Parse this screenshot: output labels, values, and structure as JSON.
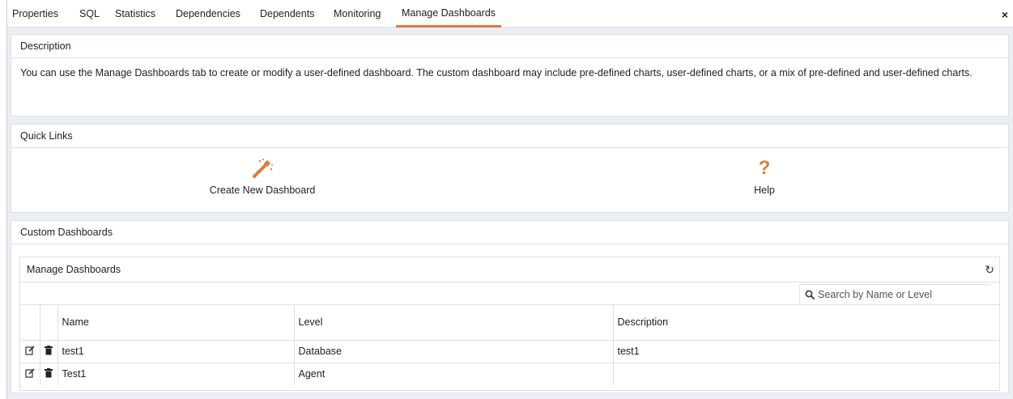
{
  "tabs": [
    {
      "label": "Properties"
    },
    {
      "label": "SQL"
    },
    {
      "label": "Statistics"
    },
    {
      "label": "Dependencies"
    },
    {
      "label": "Dependents"
    },
    {
      "label": "Monitoring"
    },
    {
      "label": "Manage Dashboards",
      "active": true
    }
  ],
  "close_label": "×",
  "description": {
    "title": "Description",
    "text": "You can use the Manage Dashboards tab to create or modify a user-defined dashboard. The custom dashboard may include pre-defined charts, user-defined charts, or a mix of pre-defined and user-defined charts."
  },
  "quick_links": {
    "title": "Quick Links",
    "create_label": "Create New Dashboard",
    "help_label": "Help",
    "help_glyph": "?"
  },
  "custom_dashboards": {
    "title": "Custom Dashboards",
    "grid_title": "Manage Dashboards",
    "refresh_glyph": "↻",
    "search_placeholder": "Search by Name or Level",
    "columns": [
      "Name",
      "Level",
      "Description"
    ],
    "rows": [
      {
        "name": "test1",
        "level": "Database",
        "description": "test1"
      },
      {
        "name": "Test1",
        "level": "Agent",
        "description": ""
      }
    ]
  },
  "colors": {
    "accent": "#e07a3c",
    "panel_bg": "#ebeef3",
    "border": "#dde0e6"
  }
}
